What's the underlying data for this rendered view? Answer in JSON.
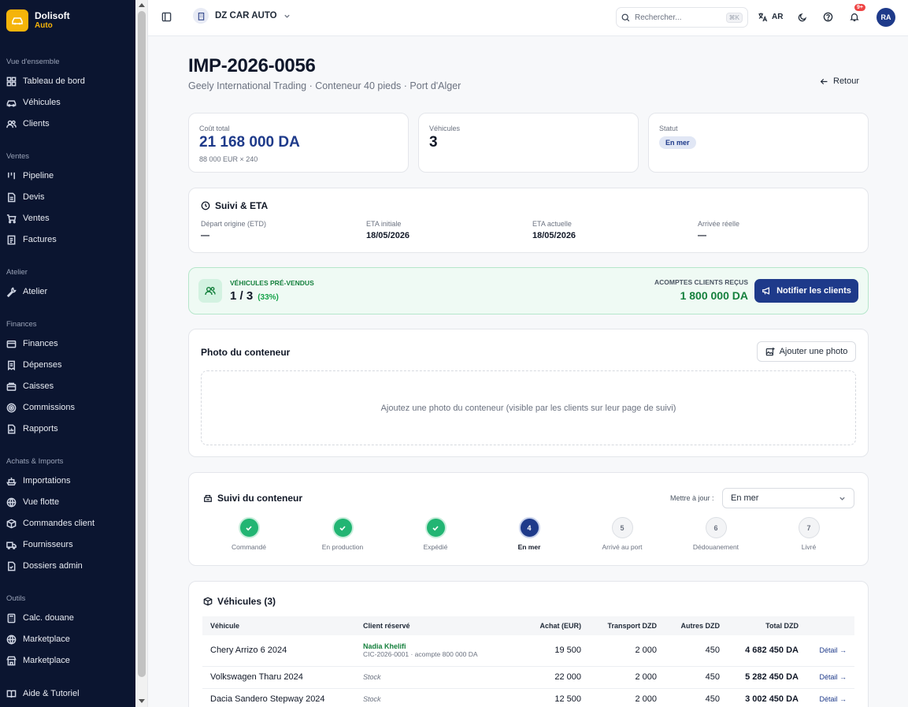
{
  "sidebar": {
    "brand": {
      "name": "Dolisoft",
      "sub": "Auto"
    },
    "sections": [
      {
        "title": "Vue d'ensemble",
        "items": [
          "Tableau de bord",
          "Véhicules",
          "Clients"
        ]
      },
      {
        "title": "Ventes",
        "items": [
          "Pipeline",
          "Devis",
          "Ventes",
          "Factures"
        ]
      },
      {
        "title": "Atelier",
        "items": [
          "Atelier"
        ]
      },
      {
        "title": "Finances",
        "items": [
          "Finances",
          "Dépenses",
          "Caisses",
          "Commissions",
          "Rapports"
        ]
      },
      {
        "title": "Achats & Imports",
        "items": [
          "Importations",
          "Vue flotte",
          "Commandes client",
          "Fournisseurs",
          "Dossiers admin"
        ]
      },
      {
        "title": "Outils",
        "items": [
          "Calc. douane",
          "Marketplace",
          "Marketplace"
        ]
      }
    ],
    "help": "Aide & Tutoriel"
  },
  "topbar": {
    "company": "DZ CAR AUTO",
    "search_placeholder": "Rechercher...",
    "search_shortcut": "⌘K",
    "lang": "AR",
    "notif_count": "9+",
    "avatar": "RA"
  },
  "header": {
    "title": "IMP-2026-0056",
    "subtitle": "Geely International Trading · Conteneur 40 pieds · Port d'Alger",
    "back": "Retour"
  },
  "stats": {
    "cost_label": "Coût total",
    "cost_value": "21 168 000 DA",
    "cost_detail": "88 000 EUR × 240",
    "vehicles_label": "Véhicules",
    "vehicles_value": "3",
    "status_label": "Statut",
    "status_value": "En mer"
  },
  "tracking": {
    "title": "Suivi & ETA",
    "fields": [
      {
        "label": "Départ origine (ETD)",
        "value": "—"
      },
      {
        "label": "ETA initiale",
        "value": "18/05/2026"
      },
      {
        "label": "ETA actuelle",
        "value": "18/05/2026"
      },
      {
        "label": "Arrivée réelle",
        "value": "—"
      }
    ]
  },
  "presold": {
    "label": "VÉHICULES PRÉ-VENDUS",
    "value": "1 / 3",
    "pct": "(33%)",
    "deposits_label": "ACOMPTES CLIENTS REÇUS",
    "deposits_value": "1 800 000 DA",
    "button": "Notifier les clients"
  },
  "photo": {
    "title": "Photo du conteneur",
    "button": "Ajouter une photo",
    "hint": "Ajoutez une photo du conteneur (visible par les clients sur leur page de suivi)"
  },
  "container": {
    "title": "Suivi du conteneur",
    "update_label": "Mettre à jour :",
    "update_value": "En mer",
    "steps": [
      {
        "label": "Commandé",
        "num": "1"
      },
      {
        "label": "En production",
        "num": "2"
      },
      {
        "label": "Expédié",
        "num": "3"
      },
      {
        "label": "En mer",
        "num": "4"
      },
      {
        "label": "Arrivé au port",
        "num": "5"
      },
      {
        "label": "Dédouanement",
        "num": "6"
      },
      {
        "label": "Livré",
        "num": "7"
      }
    ],
    "current_step": 4
  },
  "vehicles": {
    "title": "Véhicules (3)",
    "columns": [
      "Véhicule",
      "Client réservé",
      "Achat (EUR)",
      "Transport DZD",
      "Autres DZD",
      "Total DZD"
    ],
    "rows": [
      {
        "vehicle": "Chery Arrizo 6 2024",
        "client": "Nadia Khelifi",
        "client_sub": "CIC-2026-0001 · acompte 800 000 DA",
        "achat": "19 500",
        "transport": "2 000",
        "autres": "450",
        "total": "4 682 450 DA",
        "action": "Détail →"
      },
      {
        "vehicle": "Volkswagen Tharu 2024",
        "client": "Stock",
        "client_sub": "",
        "achat": "22 000",
        "transport": "2 000",
        "autres": "450",
        "total": "5 282 450 DA",
        "action": "Détail →"
      },
      {
        "vehicle": "Dacia Sandero Stepway 2024",
        "client": "Stock",
        "client_sub": "",
        "achat": "12 500",
        "transport": "2 000",
        "autres": "450",
        "total": "3 002 450 DA",
        "action": "Détail →"
      }
    ]
  }
}
